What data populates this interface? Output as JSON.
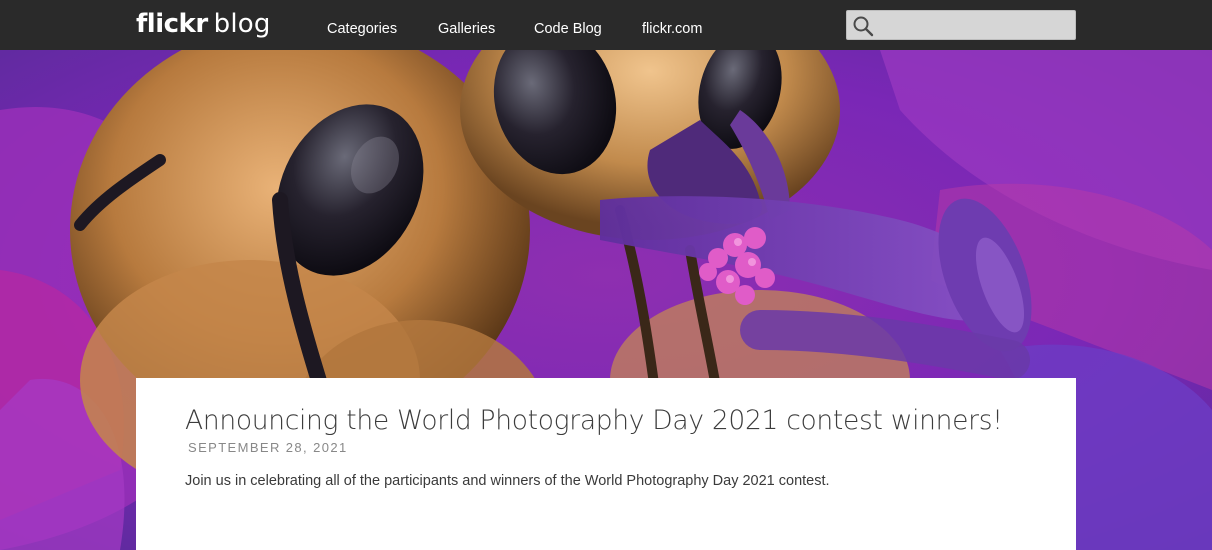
{
  "header": {
    "logo_brand": "flickr",
    "logo_sub": "blog",
    "nav": [
      "Categories",
      "Galleries",
      "Code Blog",
      "flickr.com"
    ],
    "search": {
      "placeholder": "",
      "value": ""
    }
  },
  "hero": {
    "alt": "Macro photograph of bees on a purple flower"
  },
  "post": {
    "title": "Announcing the World Photography Day 2021 contest winners!",
    "date": "SEPTEMBER 28, 2021",
    "excerpt": "Join us in celebrating all of the participants and winners of the World Photography Day 2021 contest."
  },
  "colors": {
    "nav_bg": "#2a2a2a",
    "card_bg": "#ffffff",
    "title": "#3c3c3c",
    "date": "#888888",
    "search_bg": "#d6d6d6"
  }
}
